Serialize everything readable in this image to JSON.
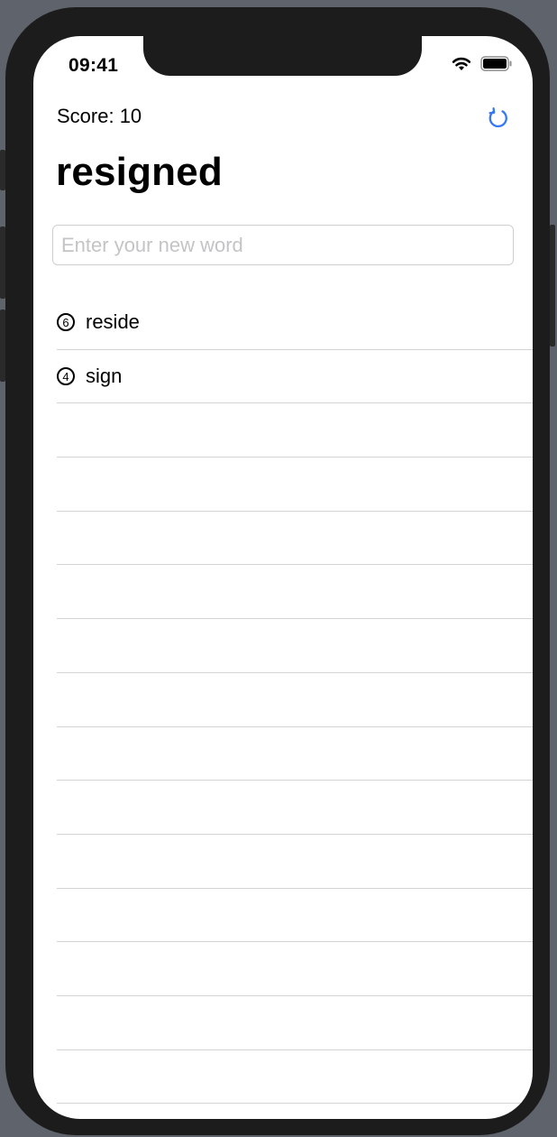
{
  "status_bar": {
    "time": "09:41",
    "icons": [
      "wifi-icon",
      "battery-icon"
    ]
  },
  "header": {
    "score_text": "Score: 10",
    "refresh_icon": "refresh-icon",
    "accent_color": "#3478f6"
  },
  "title": "resigned",
  "input": {
    "placeholder": "Enter your new word",
    "value": ""
  },
  "words": [
    {
      "length": "6",
      "word": "reside"
    },
    {
      "length": "4",
      "word": "sign"
    }
  ]
}
